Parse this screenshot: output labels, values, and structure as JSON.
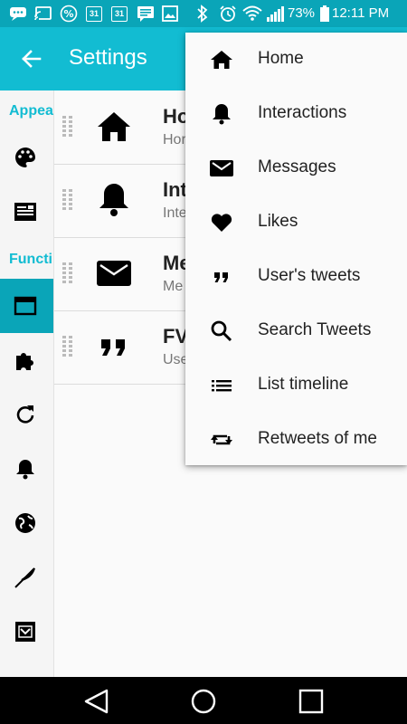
{
  "status_bar": {
    "calendar_day_1": "31",
    "calendar_day_2": "31",
    "battery_percent": "73%",
    "time": "12:11 PM",
    "icons": [
      "chat-icon",
      "cast-icon",
      "percent-icon",
      "calendar-icon",
      "calendar-icon",
      "message-icon",
      "image-icon",
      "bluetooth-icon",
      "alarm-icon",
      "wifi-icon",
      "signal-icon",
      "battery-icon"
    ]
  },
  "app_bar": {
    "title": "Settings",
    "back_icon": "arrow-back-icon",
    "color": "#12bcd2"
  },
  "sidebar": {
    "section_appearance": "Appea",
    "section_functions": "Functi",
    "icons": [
      "palette-icon",
      "compose-icon",
      "tab-icon",
      "puzzle-icon",
      "refresh-icon",
      "bell-icon",
      "globe-icon",
      "feather-icon",
      "app-icon"
    ],
    "selected_color": "#0aa5b8",
    "accent_color": "#12bcd2"
  },
  "list": {
    "rows": [
      {
        "title": "Ho",
        "subtitle": "Hor",
        "icon": "home-icon"
      },
      {
        "title": "Int",
        "subtitle": "Inte",
        "icon": "bell-icon"
      },
      {
        "title": "Me",
        "subtitle": "Me",
        "icon": "mail-icon"
      },
      {
        "title": "FV",
        "subtitle": "Use",
        "icon": "quote-icon"
      }
    ]
  },
  "menu": {
    "items": [
      {
        "label": "Home",
        "icon": "home-icon"
      },
      {
        "label": "Interactions",
        "icon": "bell-icon"
      },
      {
        "label": "Messages",
        "icon": "mail-icon"
      },
      {
        "label": "Likes",
        "icon": "heart-icon"
      },
      {
        "label": "User's tweets",
        "icon": "quote-icon"
      },
      {
        "label": "Search Tweets",
        "icon": "search-icon"
      },
      {
        "label": "List timeline",
        "icon": "list-icon"
      },
      {
        "label": "Retweets of me",
        "icon": "retweet-icon"
      }
    ]
  },
  "nav_bar": {
    "icons": [
      "back-triangle-icon",
      "home-circle-icon",
      "recents-square-icon"
    ]
  }
}
